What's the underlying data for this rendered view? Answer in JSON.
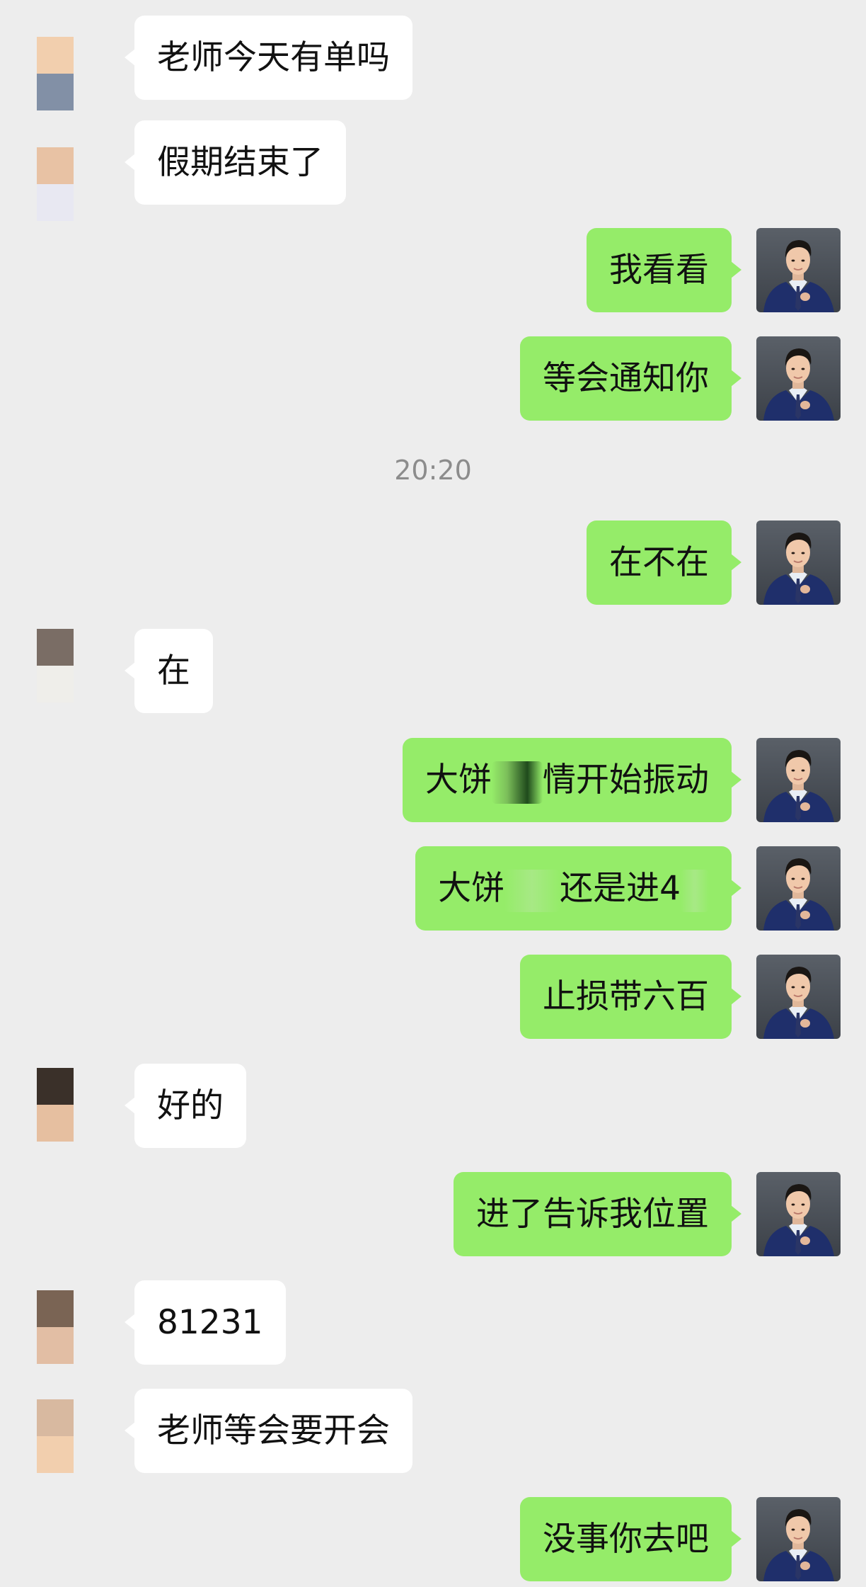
{
  "colors": {
    "background": "#ededed",
    "incoming_bubble": "#ffffff",
    "outgoing_bubble": "#95ec69",
    "timestamp_text": "#8c8c8c"
  },
  "messages": [
    {
      "side": "left",
      "text": "老师今天有单吗",
      "avatar_colors": [
        "#f2cfae",
        "#8290a6"
      ]
    },
    {
      "side": "left",
      "text": "假期结束了",
      "avatar_colors": [
        "#e8c2a4",
        "#e8e8f2"
      ]
    },
    {
      "side": "right",
      "text": "我看看"
    },
    {
      "side": "right",
      "text": "等会通知你"
    },
    {
      "timestamp": "20:20"
    },
    {
      "side": "right",
      "text": "在不在"
    },
    {
      "side": "left",
      "text": "在",
      "avatar_colors": [
        "#7a6d65",
        "#efeeea"
      ]
    },
    {
      "side": "right",
      "text_parts": [
        "大饼",
        "",
        "情开始振动"
      ]
    },
    {
      "side": "right",
      "text_parts": [
        "大饼",
        "",
        "还是进4"
      ]
    },
    {
      "side": "right",
      "text": "止损带六百"
    },
    {
      "side": "left",
      "text": "好的",
      "avatar_colors": [
        "#3a3029",
        "#e6bfa0"
      ]
    },
    {
      "side": "right",
      "text": "进了告诉我位置"
    },
    {
      "side": "left",
      "text": "81231",
      "avatar_colors": [
        "#7a6454",
        "#e2bea4"
      ]
    },
    {
      "side": "left",
      "text": "老师等会要开会",
      "avatar_colors": [
        "#d8b9a0",
        "#f2cfae"
      ]
    },
    {
      "side": "right",
      "text": "没事你去吧"
    }
  ],
  "self_avatar": {
    "icon": "profile-photo-man-in-suit"
  }
}
